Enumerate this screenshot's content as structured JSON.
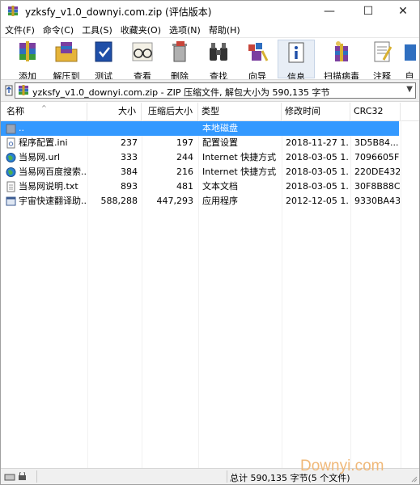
{
  "window": {
    "title": "yzksfy_v1.0_downyi.com.zip (评估版本)",
    "min_glyph": "—",
    "max_glyph": "☐",
    "close_glyph": "✕"
  },
  "menu": [
    "文件(F)",
    "命令(C)",
    "工具(S)",
    "收藏夹(O)",
    "选项(N)",
    "帮助(H)"
  ],
  "toolbar": [
    {
      "label": "添加",
      "icon": "add-archive-icon"
    },
    {
      "label": "解压到",
      "icon": "extract-folder-icon"
    },
    {
      "label": "测试",
      "icon": "test-book-icon"
    },
    {
      "label": "查看",
      "icon": "view-glasses-icon"
    },
    {
      "label": "删除",
      "icon": "delete-trash-icon"
    },
    {
      "label": "查找",
      "icon": "find-binoculars-icon"
    },
    {
      "label": "向导",
      "icon": "wizard-icon"
    },
    {
      "label": "信息",
      "icon": "info-icon"
    },
    {
      "label": "扫描病毒",
      "icon": "virus-scan-icon"
    },
    {
      "label": "注释",
      "icon": "comment-icon"
    },
    {
      "label": "自",
      "icon": "sfx-icon"
    }
  ],
  "address": {
    "path": "yzksfy_v1.0_downyi.com.zip - ZIP 压缩文件, 解包大小为 590,135 字节"
  },
  "columns": {
    "name": "名称",
    "size": "大小",
    "packed": "压缩后大小",
    "type": "类型",
    "modified": "修改时间",
    "crc": "CRC32"
  },
  "rows": [
    {
      "name": "..",
      "size": "",
      "packed": "",
      "type": "本地磁盘",
      "modified": "",
      "crc": "",
      "icon": "parent-folder-icon",
      "selected": true
    },
    {
      "name": "程序配置.ini",
      "size": "237",
      "packed": "197",
      "type": "配置设置",
      "modified": "2018-11-27 1...",
      "crc": "3D5B84...",
      "icon": "ini-file-icon",
      "selected": false
    },
    {
      "name": "当易网.url",
      "size": "333",
      "packed": "244",
      "type": "Internet 快捷方式",
      "modified": "2018-03-05 1...",
      "crc": "7096605F",
      "icon": "url-globe-icon",
      "selected": false
    },
    {
      "name": "当易网百度搜索...",
      "size": "384",
      "packed": "216",
      "type": "Internet 快捷方式",
      "modified": "2018-03-05 1...",
      "crc": "220DE432",
      "icon": "url-globe-icon",
      "selected": false
    },
    {
      "name": "当易网说明.txt",
      "size": "893",
      "packed": "481",
      "type": "文本文档",
      "modified": "2018-03-05 1...",
      "crc": "30F8B88C",
      "icon": "txt-file-icon",
      "selected": false
    },
    {
      "name": "宇宙快速翻译助...",
      "size": "588,288",
      "packed": "447,293",
      "type": "应用程序",
      "modified": "2012-12-05 1...",
      "crc": "9330BA43",
      "icon": "exe-app-icon",
      "selected": false
    }
  ],
  "status": {
    "summary": "总计 590,135 字节(5 个文件)"
  },
  "watermark": "Downyi.com"
}
